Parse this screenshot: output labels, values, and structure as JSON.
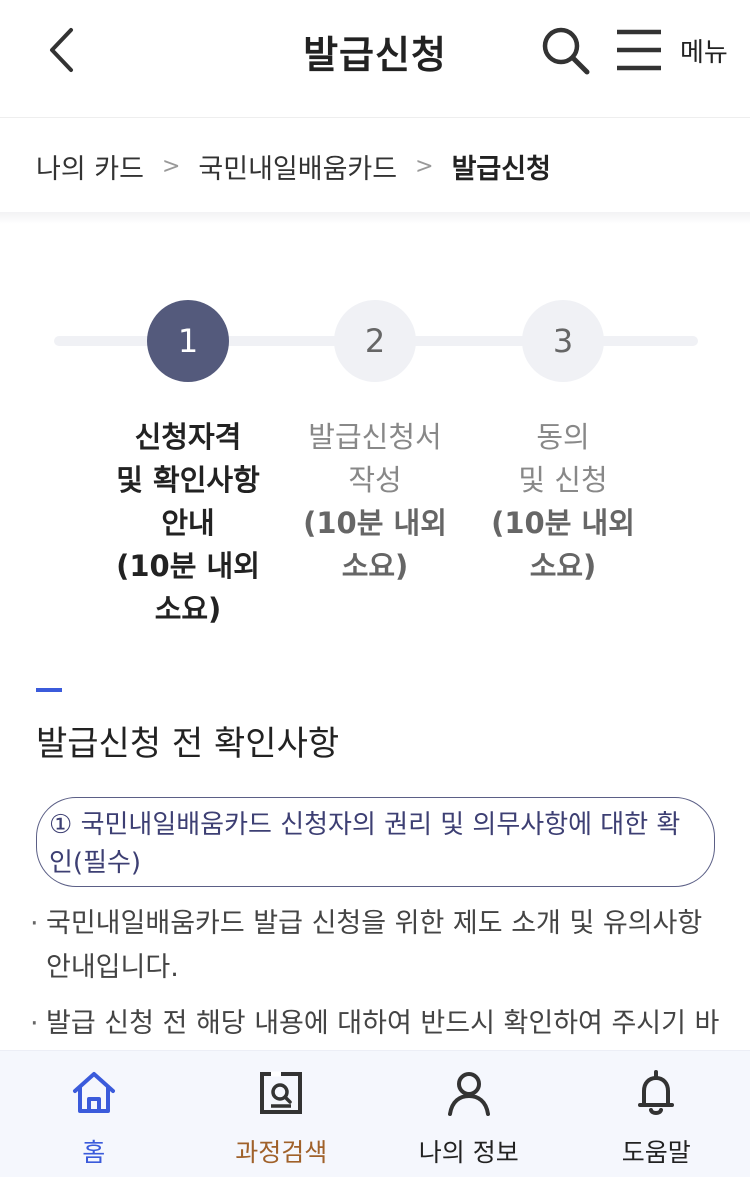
{
  "header": {
    "title": "발급신청",
    "menu_label": "메뉴"
  },
  "breadcrumb": {
    "items": [
      "나의 카드",
      "국민내일배움카드"
    ],
    "current": "발급신청",
    "separator": ">"
  },
  "stepper": {
    "current_step": 1,
    "steps": [
      {
        "number": "1",
        "label_lines": [
          "신청자격",
          "및 확인사항",
          "안내"
        ],
        "time_lines": [
          "(10분 내외",
          "소요)"
        ],
        "active": true
      },
      {
        "number": "2",
        "label_lines": [
          "발급신청서",
          "작성"
        ],
        "time_lines": [
          "(10분 내외",
          "소요)"
        ],
        "active": false
      },
      {
        "number": "3",
        "label_lines": [
          "동의",
          "및 신청"
        ],
        "time_lines": [
          "(10분 내외",
          "소요)"
        ],
        "active": false
      }
    ]
  },
  "section": {
    "title": "발급신청 전 확인사항",
    "notice_line1": "① 국민내일배움카드 신청자의 권리 및 의무사항에 대한 확",
    "notice_line2": "인(필수)",
    "bullets": [
      {
        "line1": "국민내일배움카드 발급 신청을 위한 제도 소개 및 유의사항",
        "line2": "안내입니다."
      },
      {
        "line1": "발급 신청 전 해당 내용에 대하여 반드시 확인하여 주시기 바",
        "line2": ""
      }
    ]
  },
  "bottom_nav": {
    "items": [
      {
        "label": "홈",
        "icon": "home-icon"
      },
      {
        "label": "과정검색",
        "icon": "course-search-icon"
      },
      {
        "label": "나의 정보",
        "icon": "person-icon"
      },
      {
        "label": "도움말",
        "icon": "bell-icon"
      }
    ]
  },
  "colors": {
    "step_active": "#545a7c",
    "accent_blue": "#3b5bdb",
    "course_label": "#a0612a",
    "notice_border": "#5b5f86"
  }
}
